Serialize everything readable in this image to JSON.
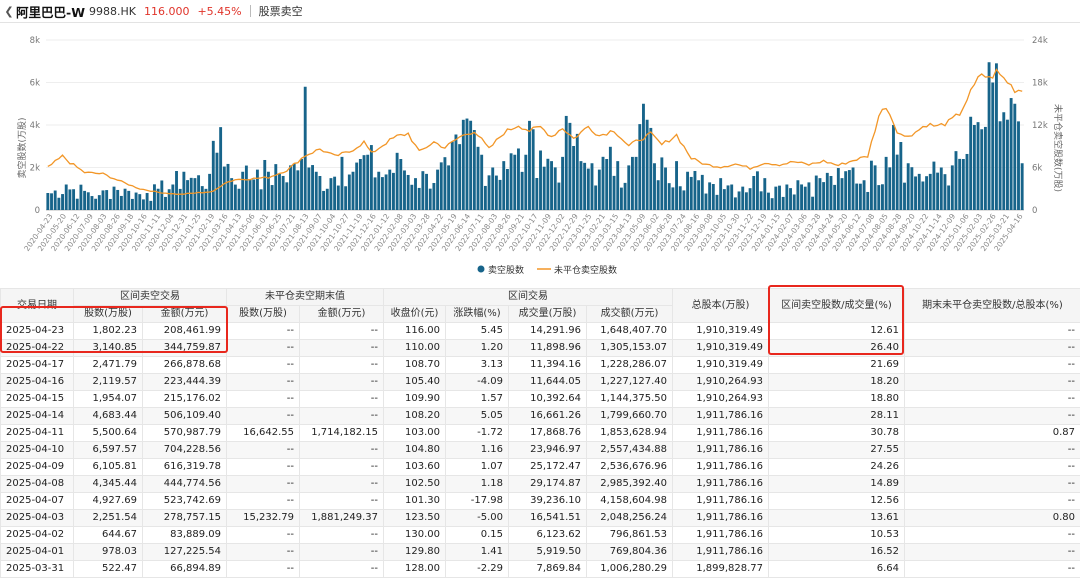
{
  "header": {
    "back_icon": "chevron-left-icon",
    "stock_name": "阿里巴巴-W",
    "stock_code": "9988.HK",
    "price": "116.000",
    "change_pct": "+5.45%",
    "section": "股票卖空"
  },
  "chart_data": {
    "type": "bar+line",
    "left_axis_label": "卖空股数(万股)",
    "right_axis_label": "未平仓卖空股数(万股)",
    "left_ticks": [
      "0",
      "2k",
      "4k",
      "6k",
      "8k"
    ],
    "right_ticks": [
      "0",
      "6k",
      "12k",
      "18k",
      "24k"
    ],
    "left_ylim": [
      0,
      8000
    ],
    "right_ylim": [
      0,
      24000
    ],
    "x_ticks": [
      "2020-04-23",
      "2020-05-20",
      "2020-06-12",
      "2020-07-09",
      "2020-08-03",
      "2020-08-26",
      "2020-09-18",
      "2020-10-16",
      "2020-11-11",
      "2020-12-04",
      "2020-12-31",
      "2021-01-25",
      "2021-02-19",
      "2021-03-16",
      "2021-04-13",
      "2021-05-06",
      "2021-06-01",
      "2021-06-25",
      "2021-07-21",
      "2021-08-13",
      "2021-09-07",
      "2021-10-04",
      "2021-10-27",
      "2021-11-19",
      "2021-12-16",
      "2022-01-12",
      "2022-02-08",
      "2022-03-03",
      "2022-03-28",
      "2022-04-22",
      "2022-05-19",
      "2022-06-14",
      "2022-07-11",
      "2022-08-03",
      "2022-08-26",
      "2022-09-21",
      "2022-10-17",
      "2022-11-09",
      "2022-12-02",
      "2022-12-29",
      "2023-01-25",
      "2023-02-21",
      "2023-03-15",
      "2023-04-13",
      "2023-05-09",
      "2023-06-02",
      "2023-06-28",
      "2023-07-24",
      "2023-08-16",
      "2023-09-08",
      "2023-10-05",
      "2023-10-30",
      "2023-11-22",
      "2023-12-19",
      "2024-01-15",
      "2024-02-07",
      "2024-03-06",
      "2024-03-28",
      "2024-04-24",
      "2024-05-20",
      "2024-06-12",
      "2024-07-08",
      "2024-08-05",
      "2024-08-28",
      "2024-09-20",
      "2024-10-22",
      "2024-11-14",
      "2024-12-09",
      "2025-01-06",
      "2025-02-03",
      "2025-02-26",
      "2025-03-21",
      "2025-04-16"
    ],
    "series": [
      {
        "name": "卖空股数",
        "type": "bar",
        "color": "#17648a",
        "anchors": [
          [
            0,
            800
          ],
          [
            5,
            1200
          ],
          [
            10,
            900
          ],
          [
            14,
            700
          ],
          [
            18,
            1100
          ],
          [
            22,
            900
          ],
          [
            27,
            800
          ],
          [
            30,
            1000
          ],
          [
            34,
            1200
          ],
          [
            37,
            1800
          ],
          [
            40,
            1500
          ],
          [
            44,
            1700
          ],
          [
            47,
            3900
          ],
          [
            50,
            1500
          ],
          [
            53,
            1800
          ],
          [
            57,
            1900
          ],
          [
            60,
            1800
          ],
          [
            63,
            1700
          ],
          [
            66,
            2100
          ],
          [
            69,
            2400
          ],
          [
            70,
            5800
          ],
          [
            71,
            2000
          ],
          [
            74,
            1600
          ],
          [
            77,
            1500
          ],
          [
            80,
            2500
          ],
          [
            83,
            1800
          ],
          [
            85,
            2400
          ],
          [
            87,
            2600
          ],
          [
            90,
            1800
          ],
          [
            93,
            1900
          ],
          [
            96,
            2400
          ],
          [
            100,
            1500
          ],
          [
            103,
            1700
          ],
          [
            106,
            1900
          ],
          [
            109,
            2100
          ],
          [
            112,
            3100
          ],
          [
            115,
            4200
          ],
          [
            118,
            2600
          ],
          [
            121,
            2000
          ],
          [
            124,
            2300
          ],
          [
            127,
            2600
          ],
          [
            130,
            2600
          ],
          [
            132,
            3800
          ],
          [
            134,
            2800
          ],
          [
            137,
            2300
          ],
          [
            140,
            2500
          ],
          [
            142,
            4100
          ],
          [
            145,
            2300
          ],
          [
            148,
            2200
          ],
          [
            150,
            1900
          ],
          [
            152,
            2400
          ],
          [
            155,
            2300
          ],
          [
            158,
            2100
          ],
          [
            160,
            2500
          ],
          [
            162,
            5000
          ],
          [
            165,
            2200
          ],
          [
            168,
            2000
          ],
          [
            171,
            2300
          ],
          [
            174,
            1800
          ],
          [
            177,
            1400
          ],
          [
            180,
            1300
          ],
          [
            183,
            1500
          ],
          [
            186,
            1200
          ],
          [
            189,
            1100
          ],
          [
            192,
            1600
          ],
          [
            195,
            1500
          ],
          [
            198,
            1100
          ],
          [
            201,
            1200
          ],
          [
            204,
            1400
          ],
          [
            207,
            1300
          ],
          [
            210,
            1500
          ],
          [
            213,
            1600
          ],
          [
            216,
            1500
          ],
          [
            219,
            2000
          ],
          [
            222,
            1400
          ],
          [
            225,
            2100
          ],
          [
            228,
            2500
          ],
          [
            230,
            4000
          ],
          [
            232,
            3200
          ],
          [
            234,
            2200
          ],
          [
            237,
            1700
          ],
          [
            240,
            1700
          ],
          [
            243,
            2000
          ],
          [
            246,
            2100
          ],
          [
            249,
            2400
          ],
          [
            252,
            4000
          ],
          [
            254,
            3800
          ],
          [
            257,
            6000
          ],
          [
            260,
            4600
          ],
          [
            263,
            5000
          ],
          [
            265,
            2200
          ]
        ]
      },
      {
        "name": "未平仓卖空股数",
        "type": "line",
        "color": "#f29627",
        "anchors": [
          [
            0,
            6000
          ],
          [
            4,
            7600
          ],
          [
            6,
            6700
          ],
          [
            10,
            5300
          ],
          [
            15,
            5100
          ],
          [
            20,
            4000
          ],
          [
            25,
            3000
          ],
          [
            30,
            2500
          ],
          [
            36,
            2200
          ],
          [
            40,
            2400
          ],
          [
            45,
            2600
          ],
          [
            48,
            3800
          ],
          [
            51,
            4300
          ],
          [
            55,
            4400
          ],
          [
            60,
            4600
          ],
          [
            65,
            5600
          ],
          [
            70,
            7700
          ],
          [
            74,
            8600
          ],
          [
            78,
            7600
          ],
          [
            82,
            8200
          ],
          [
            86,
            9600
          ],
          [
            88,
            8000
          ],
          [
            92,
            9500
          ],
          [
            95,
            10400
          ],
          [
            98,
            10800
          ],
          [
            101,
            8200
          ],
          [
            105,
            9600
          ],
          [
            108,
            8800
          ],
          [
            112,
            10300
          ],
          [
            116,
            11200
          ],
          [
            120,
            8600
          ],
          [
            124,
            10900
          ],
          [
            128,
            12000
          ],
          [
            131,
            11200
          ],
          [
            134,
            11700
          ],
          [
            137,
            10400
          ],
          [
            140,
            11600
          ],
          [
            143,
            10100
          ],
          [
            147,
            11800
          ],
          [
            150,
            10500
          ],
          [
            154,
            11300
          ],
          [
            158,
            9000
          ],
          [
            161,
            10000
          ],
          [
            164,
            10700
          ],
          [
            167,
            9200
          ],
          [
            171,
            10600
          ],
          [
            175,
            7300
          ],
          [
            179,
            6400
          ],
          [
            183,
            6100
          ],
          [
            187,
            6500
          ],
          [
            191,
            5900
          ],
          [
            195,
            6700
          ],
          [
            199,
            6400
          ],
          [
            203,
            6800
          ],
          [
            207,
            6400
          ],
          [
            211,
            6900
          ],
          [
            215,
            6300
          ],
          [
            219,
            7000
          ],
          [
            223,
            7600
          ],
          [
            226,
            13300
          ],
          [
            228,
            14700
          ],
          [
            231,
            11200
          ],
          [
            233,
            10300
          ],
          [
            236,
            11000
          ],
          [
            239,
            12100
          ],
          [
            242,
            11800
          ],
          [
            245,
            12400
          ],
          [
            248,
            13600
          ],
          [
            251,
            16600
          ],
          [
            254,
            19300
          ],
          [
            256,
            18500
          ],
          [
            258,
            19500
          ],
          [
            261,
            18100
          ],
          [
            263,
            17000
          ],
          [
            265,
            16900
          ]
        ]
      }
    ],
    "legend": [
      "卖空股数",
      "未平仓卖空股数"
    ],
    "legend_position": "bottom-center",
    "grid": true
  },
  "table": {
    "group_headers": {
      "date": "交易日期",
      "interval": "区间卖空交易",
      "unclosed": "未平仓卖空期末值",
      "trade": "区间交易",
      "total_equity": "总股本(万股)",
      "ratio_vol": "区间卖空股数/成交量(%)",
      "ratio_total": "期末未平仓卖空股数/总股本(%)"
    },
    "sub_headers": {
      "shares": "股数(万股)",
      "amount": "金额(万元)",
      "u_shares": "股数(万股)",
      "u_amount": "金额(万元)",
      "close": "收盘价(元)",
      "chg": "涨跌幅(%)",
      "volume": "成交量(万股)",
      "turnover": "成交额(万元)"
    },
    "rows": [
      {
        "date": "2025-04-23",
        "shares": "1,802.23",
        "amount": "208,461.99",
        "u_shares": "--",
        "u_amount": "--",
        "close": "116.00",
        "chg": "5.45",
        "volume": "14,291.96",
        "turnover": "1,648,407.70",
        "total": "1,910,319.49",
        "ratio": "12.61",
        "ratio2": "--"
      },
      {
        "date": "2025-04-22",
        "shares": "3,140.85",
        "amount": "344,759.87",
        "u_shares": "--",
        "u_amount": "--",
        "close": "110.00",
        "chg": "1.20",
        "volume": "11,898.96",
        "turnover": "1,305,153.07",
        "total": "1,910,319.49",
        "ratio": "26.40",
        "ratio2": "--"
      },
      {
        "date": "2025-04-17",
        "shares": "2,471.79",
        "amount": "266,878.68",
        "u_shares": "--",
        "u_amount": "--",
        "close": "108.70",
        "chg": "3.13",
        "volume": "11,394.16",
        "turnover": "1,228,286.07",
        "total": "1,910,319.49",
        "ratio": "21.69",
        "ratio2": "--"
      },
      {
        "date": "2025-04-16",
        "shares": "2,119.57",
        "amount": "223,444.39",
        "u_shares": "--",
        "u_amount": "--",
        "close": "105.40",
        "chg": "-4.09",
        "volume": "11,644.05",
        "turnover": "1,227,127.40",
        "total": "1,910,264.93",
        "ratio": "18.20",
        "ratio2": "--"
      },
      {
        "date": "2025-04-15",
        "shares": "1,954.07",
        "amount": "215,176.02",
        "u_shares": "--",
        "u_amount": "--",
        "close": "109.90",
        "chg": "1.57",
        "volume": "10,392.64",
        "turnover": "1,144,375.50",
        "total": "1,910,264.93",
        "ratio": "18.80",
        "ratio2": "--"
      },
      {
        "date": "2025-04-14",
        "shares": "4,683.44",
        "amount": "506,109.40",
        "u_shares": "--",
        "u_amount": "--",
        "close": "108.20",
        "chg": "5.05",
        "volume": "16,661.26",
        "turnover": "1,799,660.70",
        "total": "1,911,786.16",
        "ratio": "28.11",
        "ratio2": "--"
      },
      {
        "date": "2025-04-11",
        "shares": "5,500.64",
        "amount": "570,987.79",
        "u_shares": "16,642.55",
        "u_amount": "1,714,182.15",
        "close": "103.00",
        "chg": "-1.72",
        "volume": "17,868.76",
        "turnover": "1,853,628.94",
        "total": "1,911,786.16",
        "ratio": "30.78",
        "ratio2": "0.87"
      },
      {
        "date": "2025-04-10",
        "shares": "6,597.57",
        "amount": "704,228.56",
        "u_shares": "--",
        "u_amount": "--",
        "close": "104.80",
        "chg": "1.16",
        "volume": "23,946.97",
        "turnover": "2,557,434.88",
        "total": "1,911,786.16",
        "ratio": "27.55",
        "ratio2": "--"
      },
      {
        "date": "2025-04-09",
        "shares": "6,105.81",
        "amount": "616,319.78",
        "u_shares": "--",
        "u_amount": "--",
        "close": "103.60",
        "chg": "1.07",
        "volume": "25,172.47",
        "turnover": "2,536,676.96",
        "total": "1,911,786.16",
        "ratio": "24.26",
        "ratio2": "--"
      },
      {
        "date": "2025-04-08",
        "shares": "4,345.44",
        "amount": "444,774.56",
        "u_shares": "--",
        "u_amount": "--",
        "close": "102.50",
        "chg": "1.18",
        "volume": "29,174.87",
        "turnover": "2,985,392.40",
        "total": "1,911,786.16",
        "ratio": "14.89",
        "ratio2": "--"
      },
      {
        "date": "2025-04-07",
        "shares": "4,927.69",
        "amount": "523,742.69",
        "u_shares": "--",
        "u_amount": "--",
        "close": "101.30",
        "chg": "-17.98",
        "volume": "39,236.10",
        "turnover": "4,158,604.98",
        "total": "1,911,786.16",
        "ratio": "12.56",
        "ratio2": "--"
      },
      {
        "date": "2025-04-03",
        "shares": "2,251.54",
        "amount": "278,757.15",
        "u_shares": "15,232.79",
        "u_amount": "1,881,249.37",
        "close": "123.50",
        "chg": "-5.00",
        "volume": "16,541.51",
        "turnover": "2,048,256.24",
        "total": "1,911,786.16",
        "ratio": "13.61",
        "ratio2": "0.80"
      },
      {
        "date": "2025-04-02",
        "shares": "644.67",
        "amount": "83,889.09",
        "u_shares": "--",
        "u_amount": "--",
        "close": "130.00",
        "chg": "0.15",
        "volume": "6,123.62",
        "turnover": "796,861.53",
        "total": "1,911,786.16",
        "ratio": "10.53",
        "ratio2": "--"
      },
      {
        "date": "2025-04-01",
        "shares": "978.03",
        "amount": "127,225.54",
        "u_shares": "--",
        "u_amount": "--",
        "close": "129.80",
        "chg": "1.41",
        "volume": "5,919.50",
        "turnover": "769,804.36",
        "total": "1,911,786.16",
        "ratio": "16.52",
        "ratio2": "--"
      },
      {
        "date": "2025-03-31",
        "shares": "522.47",
        "amount": "66,894.89",
        "u_shares": "--",
        "u_amount": "--",
        "close": "128.00",
        "chg": "-2.29",
        "volume": "7,869.84",
        "turnover": "1,006,280.29",
        "total": "1,899,828.77",
        "ratio": "6.64",
        "ratio2": "--"
      }
    ]
  }
}
